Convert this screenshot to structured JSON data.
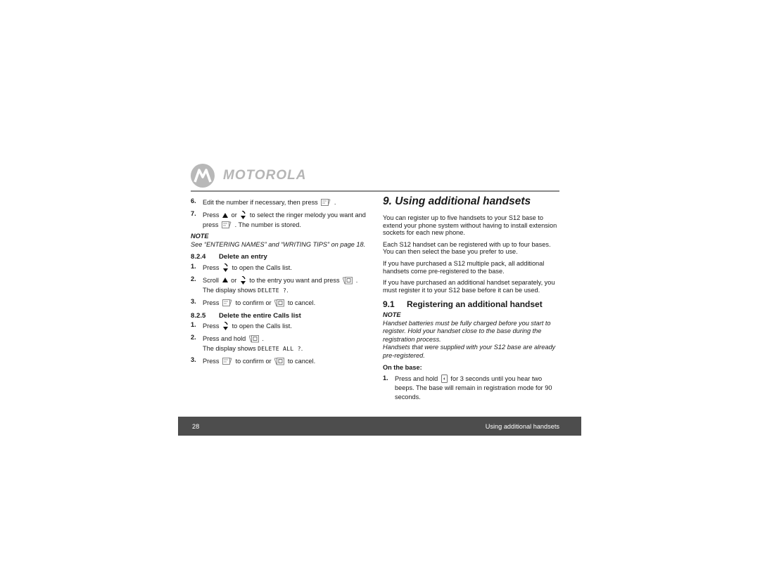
{
  "header": {
    "brand": "MOTOROLA",
    "logo_icon": "motorola-batwing-logo"
  },
  "left_column": {
    "steps_top": [
      {
        "num": "6.",
        "parts": [
          "Edit the number if necessary, then press",
          "."
        ]
      },
      {
        "num": "7.",
        "parts": [
          "Press",
          "or",
          "to select the ringer melody you want and press",
          ". The number is stored."
        ]
      }
    ],
    "note": {
      "label": "NOTE",
      "text": "See “ENTERING NAMES” and “WRITING TIPS” on page 18."
    },
    "section_824": {
      "number": "8.2.4",
      "title": "Delete an entry",
      "steps": [
        {
          "num": "1.",
          "parts": [
            "Press",
            "to open the Calls list."
          ]
        },
        {
          "num": "2.",
          "parts": [
            "Scroll",
            "or",
            "to the entry you want and press",
            "."
          ],
          "display_prefix": "The display shows",
          "display_text": "DELETE ?",
          "display_suffix": "."
        },
        {
          "num": "3.",
          "parts": [
            "Press",
            "to confirm or",
            "to cancel."
          ]
        }
      ]
    },
    "section_825": {
      "number": "8.2.5",
      "title": "Delete the entire Calls list",
      "steps": [
        {
          "num": "1.",
          "parts": [
            "Press",
            "to open the Calls list."
          ]
        },
        {
          "num": "2.",
          "parts": [
            "Press and hold",
            "."
          ],
          "display_prefix": "The display shows",
          "display_text": "DELETE ALL ?",
          "display_suffix": "."
        },
        {
          "num": "3.",
          "parts": [
            "Press",
            "to confirm or",
            "to cancel."
          ]
        }
      ]
    }
  },
  "right_column": {
    "title": "9. Using additional handsets",
    "paragraphs": [
      "You can register up to five handsets to your S12 base to extend your phone system without having to install extension sockets for each new phone.",
      "Each S12 handset can be registered with up to four bases. You can then select the base you prefer to use.",
      "If you have purchased a S12 multiple pack, all additional handsets come pre-registered to the base.",
      "If you have purchased an additional handset separately, you must register it to your S12 base before it can be used."
    ],
    "section_91": {
      "number": "9.1",
      "title": "Registering an additional handset",
      "note_label": "NOTE",
      "note_lines": [
        "Handset batteries must be fully charged before you start to register. Hold your handset close to the base during the registration process.",
        "Handsets that were supplied with your S12 base are already pre-registered."
      ],
      "on_base_label": "On the base:",
      "steps": [
        {
          "num": "1.",
          "parts": [
            "Press and hold",
            "for 3 seconds until you hear two beeps. The base will remain in registration mode for 90 seconds."
          ]
        }
      ]
    }
  },
  "footer": {
    "page_number": "28",
    "section_title": "Using additional handsets",
    "bar_color": "#4d4d4d"
  },
  "icons": {
    "menu_ok": "menu-ok-softkey-icon",
    "up": "up-arrow-icon",
    "calls_down": "calls-down-arrow-icon",
    "delete_back": "delete-back-softkey-icon",
    "base_page": "base-page-button-icon"
  }
}
